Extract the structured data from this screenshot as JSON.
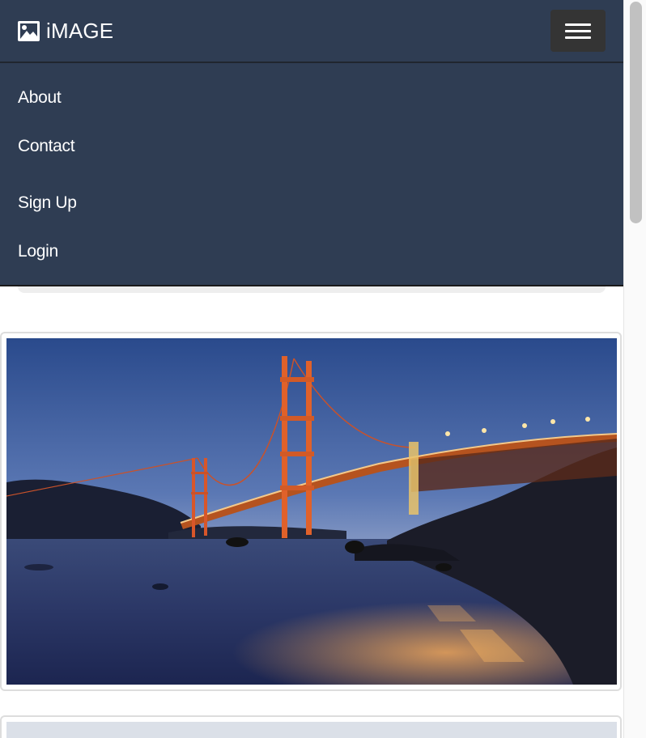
{
  "brand": {
    "name": "iMAGE",
    "icon": "picture-icon"
  },
  "navbar": {
    "toggle_icon": "hamburger-menu-icon",
    "links": [
      {
        "label": "About"
      },
      {
        "label": "Contact"
      },
      {
        "label": "Sign Up"
      },
      {
        "label": "Login"
      }
    ]
  },
  "gallery": {
    "items": [
      {
        "subject": "Golden Gate Bridge at dusk"
      },
      {
        "subject": ""
      }
    ]
  },
  "colors": {
    "navbar_bg": "#2f3d53",
    "toggle_bg": "#343434",
    "text": "#ffffff",
    "card_border": "#dddddd"
  }
}
